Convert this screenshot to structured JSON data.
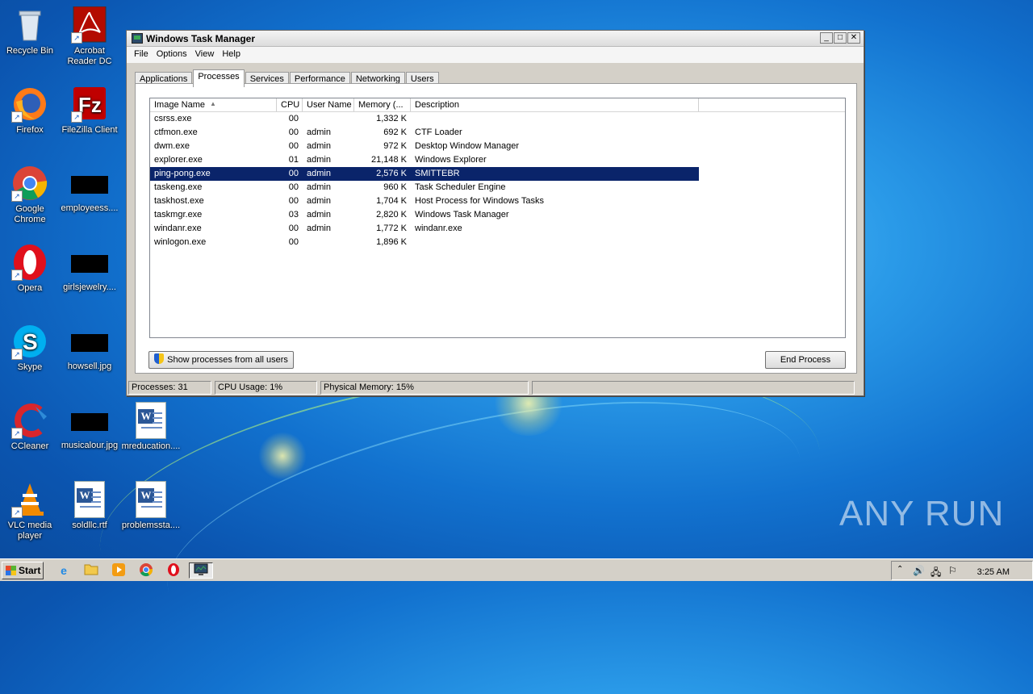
{
  "desktop": {
    "icons": [
      {
        "label": "Recycle Bin",
        "icon": "recycle-bin-icon"
      },
      {
        "label": "Acrobat Reader DC",
        "icon": "acrobat-icon"
      },
      {
        "label": "Firefox",
        "icon": "firefox-icon"
      },
      {
        "label": "FileZilla Client",
        "icon": "filezilla-icon"
      },
      {
        "label": "Google Chrome",
        "icon": "chrome-icon"
      },
      {
        "label": "employeess....",
        "icon": "image-thumbnail"
      },
      {
        "label": "Opera",
        "icon": "opera-icon"
      },
      {
        "label": "girlsjewelry....",
        "icon": "image-thumbnail"
      },
      {
        "label": "Skype",
        "icon": "skype-icon"
      },
      {
        "label": "howsell.jpg",
        "icon": "image-thumbnail"
      },
      {
        "label": "CCleaner",
        "icon": "ccleaner-icon"
      },
      {
        "label": "musicalour.jpg",
        "icon": "image-thumbnail"
      },
      {
        "label": "mreducation....",
        "icon": "word-document-icon"
      },
      {
        "label": "VLC media player",
        "icon": "vlc-icon"
      },
      {
        "label": "soldllc.rtf",
        "icon": "word-document-icon"
      },
      {
        "label": "problemssta....",
        "icon": "word-document-icon"
      }
    ]
  },
  "window": {
    "title": "Windows Task Manager",
    "menu": [
      "File",
      "Options",
      "View",
      "Help"
    ],
    "tabs": [
      "Applications",
      "Processes",
      "Services",
      "Performance",
      "Networking",
      "Users"
    ],
    "active_tab": "Processes",
    "columns": [
      "Image Name",
      "CPU",
      "User Name",
      "Memory (...",
      "Description"
    ],
    "rows": [
      {
        "name": "csrss.exe",
        "cpu": "00",
        "user": "",
        "mem": "1,332 K",
        "desc": ""
      },
      {
        "name": "ctfmon.exe",
        "cpu": "00",
        "user": "admin",
        "mem": "692 K",
        "desc": "CTF Loader"
      },
      {
        "name": "dwm.exe",
        "cpu": "00",
        "user": "admin",
        "mem": "972 K",
        "desc": "Desktop Window Manager"
      },
      {
        "name": "explorer.exe",
        "cpu": "01",
        "user": "admin",
        "mem": "21,148 K",
        "desc": "Windows Explorer"
      },
      {
        "name": "ping-pong.exe",
        "cpu": "00",
        "user": "admin",
        "mem": "2,576 K",
        "desc": "SMITTEBR",
        "selected": true
      },
      {
        "name": "taskeng.exe",
        "cpu": "00",
        "user": "admin",
        "mem": "960 K",
        "desc": "Task Scheduler Engine"
      },
      {
        "name": "taskhost.exe",
        "cpu": "00",
        "user": "admin",
        "mem": "1,704 K",
        "desc": "Host Process for Windows Tasks"
      },
      {
        "name": "taskmgr.exe",
        "cpu": "03",
        "user": "admin",
        "mem": "2,820 K",
        "desc": "Windows Task Manager"
      },
      {
        "name": "windanr.exe",
        "cpu": "00",
        "user": "admin",
        "mem": "1,772 K",
        "desc": "windanr.exe"
      },
      {
        "name": "winlogon.exe",
        "cpu": "00",
        "user": "",
        "mem": "1,896 K",
        "desc": ""
      }
    ],
    "show_all_label": "Show processes from all users",
    "end_process_label": "End Process",
    "status": {
      "processes": "Processes: 31",
      "cpu": "CPU Usage: 1%",
      "memory": "Physical Memory: 15%"
    }
  },
  "taskbar": {
    "start_label": "Start",
    "pinned": [
      "internet-explorer-icon",
      "folder-icon",
      "media-player-icon",
      "chrome-icon",
      "opera-icon",
      "task-manager-icon"
    ],
    "clock": "3:25 AM"
  },
  "watermark": "ANY RUN",
  "colors": {
    "selection": "#0a246a",
    "window_face": "#d4d0c8"
  }
}
